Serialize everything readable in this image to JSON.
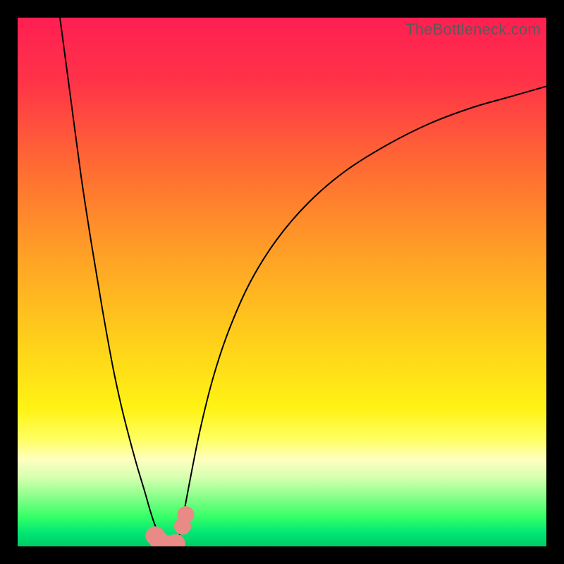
{
  "watermark": "TheBottleneck.com",
  "chart_data": {
    "type": "line",
    "title": "",
    "xlabel": "",
    "ylabel": "",
    "xlim": [
      0,
      100
    ],
    "ylim": [
      0,
      100
    ],
    "grid": false,
    "legend": false,
    "gradient_stops": [
      {
        "offset": 0.0,
        "color": "#ff1f52"
      },
      {
        "offset": 0.12,
        "color": "#ff3348"
      },
      {
        "offset": 0.28,
        "color": "#ff6a33"
      },
      {
        "offset": 0.45,
        "color": "#ffa126"
      },
      {
        "offset": 0.62,
        "color": "#ffd21a"
      },
      {
        "offset": 0.74,
        "color": "#fff314"
      },
      {
        "offset": 0.8,
        "color": "#ffff66"
      },
      {
        "offset": 0.835,
        "color": "#ffffc0"
      },
      {
        "offset": 0.87,
        "color": "#d6ffb0"
      },
      {
        "offset": 0.905,
        "color": "#8cff8c"
      },
      {
        "offset": 0.945,
        "color": "#33ff66"
      },
      {
        "offset": 0.975,
        "color": "#00e673"
      },
      {
        "offset": 1.0,
        "color": "#00cc66"
      }
    ],
    "series": [
      {
        "name": "left-branch",
        "stroke": "#000000",
        "stroke_width": 2,
        "x": [
          8.0,
          10.0,
          12.0,
          14.0,
          16.0,
          18.0,
          19.5,
          21.0,
          22.5,
          24.0,
          25.0,
          25.8,
          26.5,
          27.0,
          27.4
        ],
        "y": [
          100.0,
          85.0,
          70.0,
          57.0,
          45.0,
          34.0,
          27.0,
          21.0,
          15.5,
          10.5,
          7.0,
          4.5,
          2.8,
          1.5,
          0.8
        ]
      },
      {
        "name": "right-branch",
        "stroke": "#000000",
        "stroke_width": 2,
        "x": [
          30.3,
          31.0,
          32.5,
          34.5,
          37.0,
          40.0,
          44.0,
          49.0,
          55.0,
          62.0,
          70.0,
          78.0,
          86.0,
          93.0,
          100.0
        ],
        "y": [
          0.8,
          4.0,
          12.0,
          22.0,
          32.0,
          41.0,
          50.0,
          58.0,
          65.0,
          71.0,
          76.0,
          80.0,
          83.0,
          85.0,
          87.0
        ]
      },
      {
        "name": "valley-floor",
        "stroke": "#000000",
        "stroke_width": 2,
        "x": [
          27.4,
          27.8,
          28.3,
          28.9,
          29.5,
          30.0,
          30.3
        ],
        "y": [
          0.8,
          0.35,
          0.15,
          0.1,
          0.15,
          0.35,
          0.8
        ]
      }
    ],
    "markers": [
      {
        "name": "dip-cluster",
        "cx": 26.0,
        "cy": 2.0,
        "r": 1.8,
        "color": "#e98a86"
      },
      {
        "name": "dip-cluster",
        "cx": 26.7,
        "cy": 1.2,
        "r": 1.8,
        "color": "#e98a86"
      },
      {
        "name": "dip-cluster",
        "cx": 27.5,
        "cy": 0.5,
        "r": 1.8,
        "color": "#e98a86"
      },
      {
        "name": "dip-cluster",
        "cx": 28.3,
        "cy": 0.3,
        "r": 1.8,
        "color": "#e98a86"
      },
      {
        "name": "dip-cluster",
        "cx": 29.1,
        "cy": 0.3,
        "r": 1.8,
        "color": "#e98a86"
      },
      {
        "name": "dip-cluster",
        "cx": 29.9,
        "cy": 0.5,
        "r": 1.8,
        "color": "#e98a86"
      },
      {
        "name": "right-dot-lower",
        "cx": 31.2,
        "cy": 3.8,
        "r": 1.6,
        "color": "#e98a86"
      },
      {
        "name": "right-dot-upper",
        "cx": 31.8,
        "cy": 6.0,
        "r": 1.6,
        "color": "#e98a86"
      }
    ]
  }
}
